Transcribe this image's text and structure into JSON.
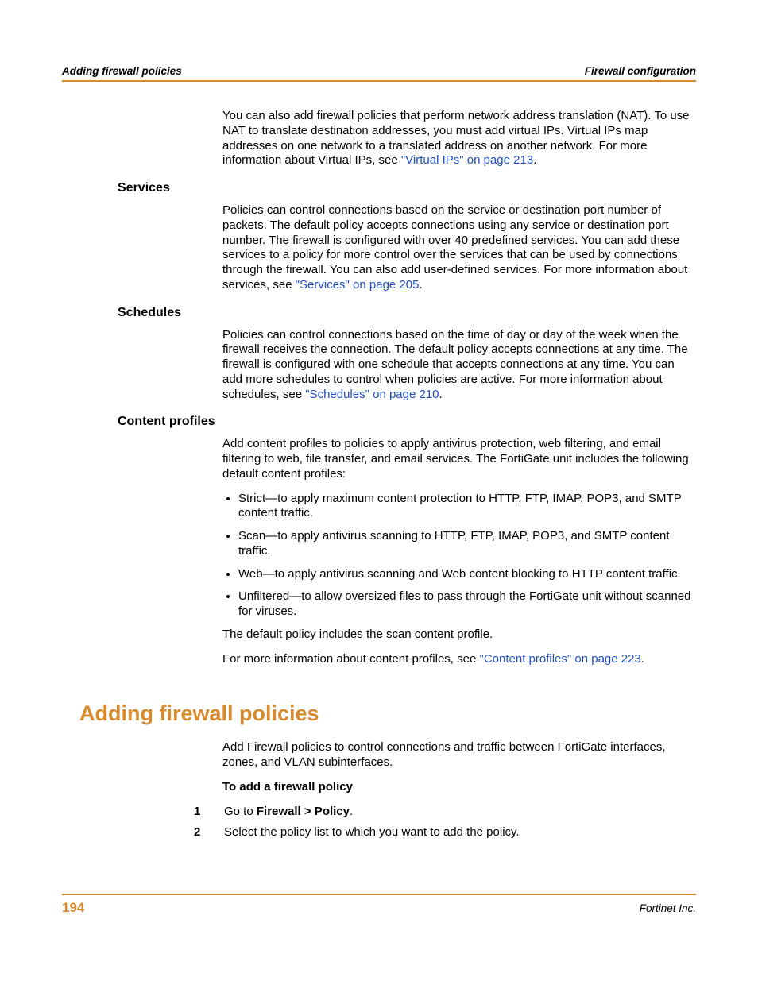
{
  "header": {
    "left": "Adding firewall policies",
    "right": "Firewall configuration"
  },
  "intro": {
    "p1a": "You can also add firewall policies that perform network address translation (NAT). To use NAT to translate destination addresses, you must add virtual IPs. Virtual IPs map addresses on one network to a translated address on another network. For more information about Virtual IPs, see ",
    "p1link": "\"Virtual IPs\" on page 213",
    "p1b": "."
  },
  "services": {
    "heading": "Services",
    "p1a": "Policies can control connections based on the service or destination port number of packets. The default policy accepts connections using any service or destination port number. The firewall is configured with over 40 predefined services. You can add these services to a policy for more control over the services that can be used by connections through the firewall. You can also add user-defined services. For more information about services, see ",
    "p1link": "\"Services\" on page 205",
    "p1b": "."
  },
  "schedules": {
    "heading": "Schedules",
    "p1a": "Policies can control connections based on the time of day or day of the week when the firewall receives the connection. The default policy accepts connections at any time. The firewall is configured with one schedule that accepts connections at any time. You can add more schedules to control when policies are active. For more information about schedules, see ",
    "p1link": "\"Schedules\" on page 210",
    "p1b": "."
  },
  "content_profiles": {
    "heading": "Content profiles",
    "intro": "Add content profiles to policies to apply antivirus protection, web filtering, and email filtering to web, file transfer, and email services. The FortiGate unit includes the following default content profiles:",
    "items": [
      "Strict—to apply maximum content protection to HTTP, FTP, IMAP, POP3, and SMTP content traffic.",
      "Scan—to apply antivirus scanning to HTTP, FTP, IMAP, POP3, and SMTP content traffic.",
      "Web—to apply antivirus scanning and Web content blocking to HTTP content traffic.",
      "Unfiltered—to allow oversized files to pass through the FortiGate unit without scanned for viruses."
    ],
    "after1": "The default policy includes the scan content profile.",
    "after2a": "For more information about content profiles, see ",
    "after2link": "\"Content profiles\" on page 223",
    "after2b": "."
  },
  "adding": {
    "heading": "Adding firewall policies",
    "intro": "Add Firewall policies to control connections and traffic between FortiGate interfaces, zones, and VLAN subinterfaces.",
    "proc_heading": "To add a firewall policy",
    "steps": [
      {
        "num": "1",
        "pre": "Go to ",
        "bold": "Firewall > Policy",
        "post": "."
      },
      {
        "num": "2",
        "pre": "Select the policy list to which you want to add the policy.",
        "bold": "",
        "post": ""
      }
    ]
  },
  "footer": {
    "page": "194",
    "company": "Fortinet Inc."
  }
}
